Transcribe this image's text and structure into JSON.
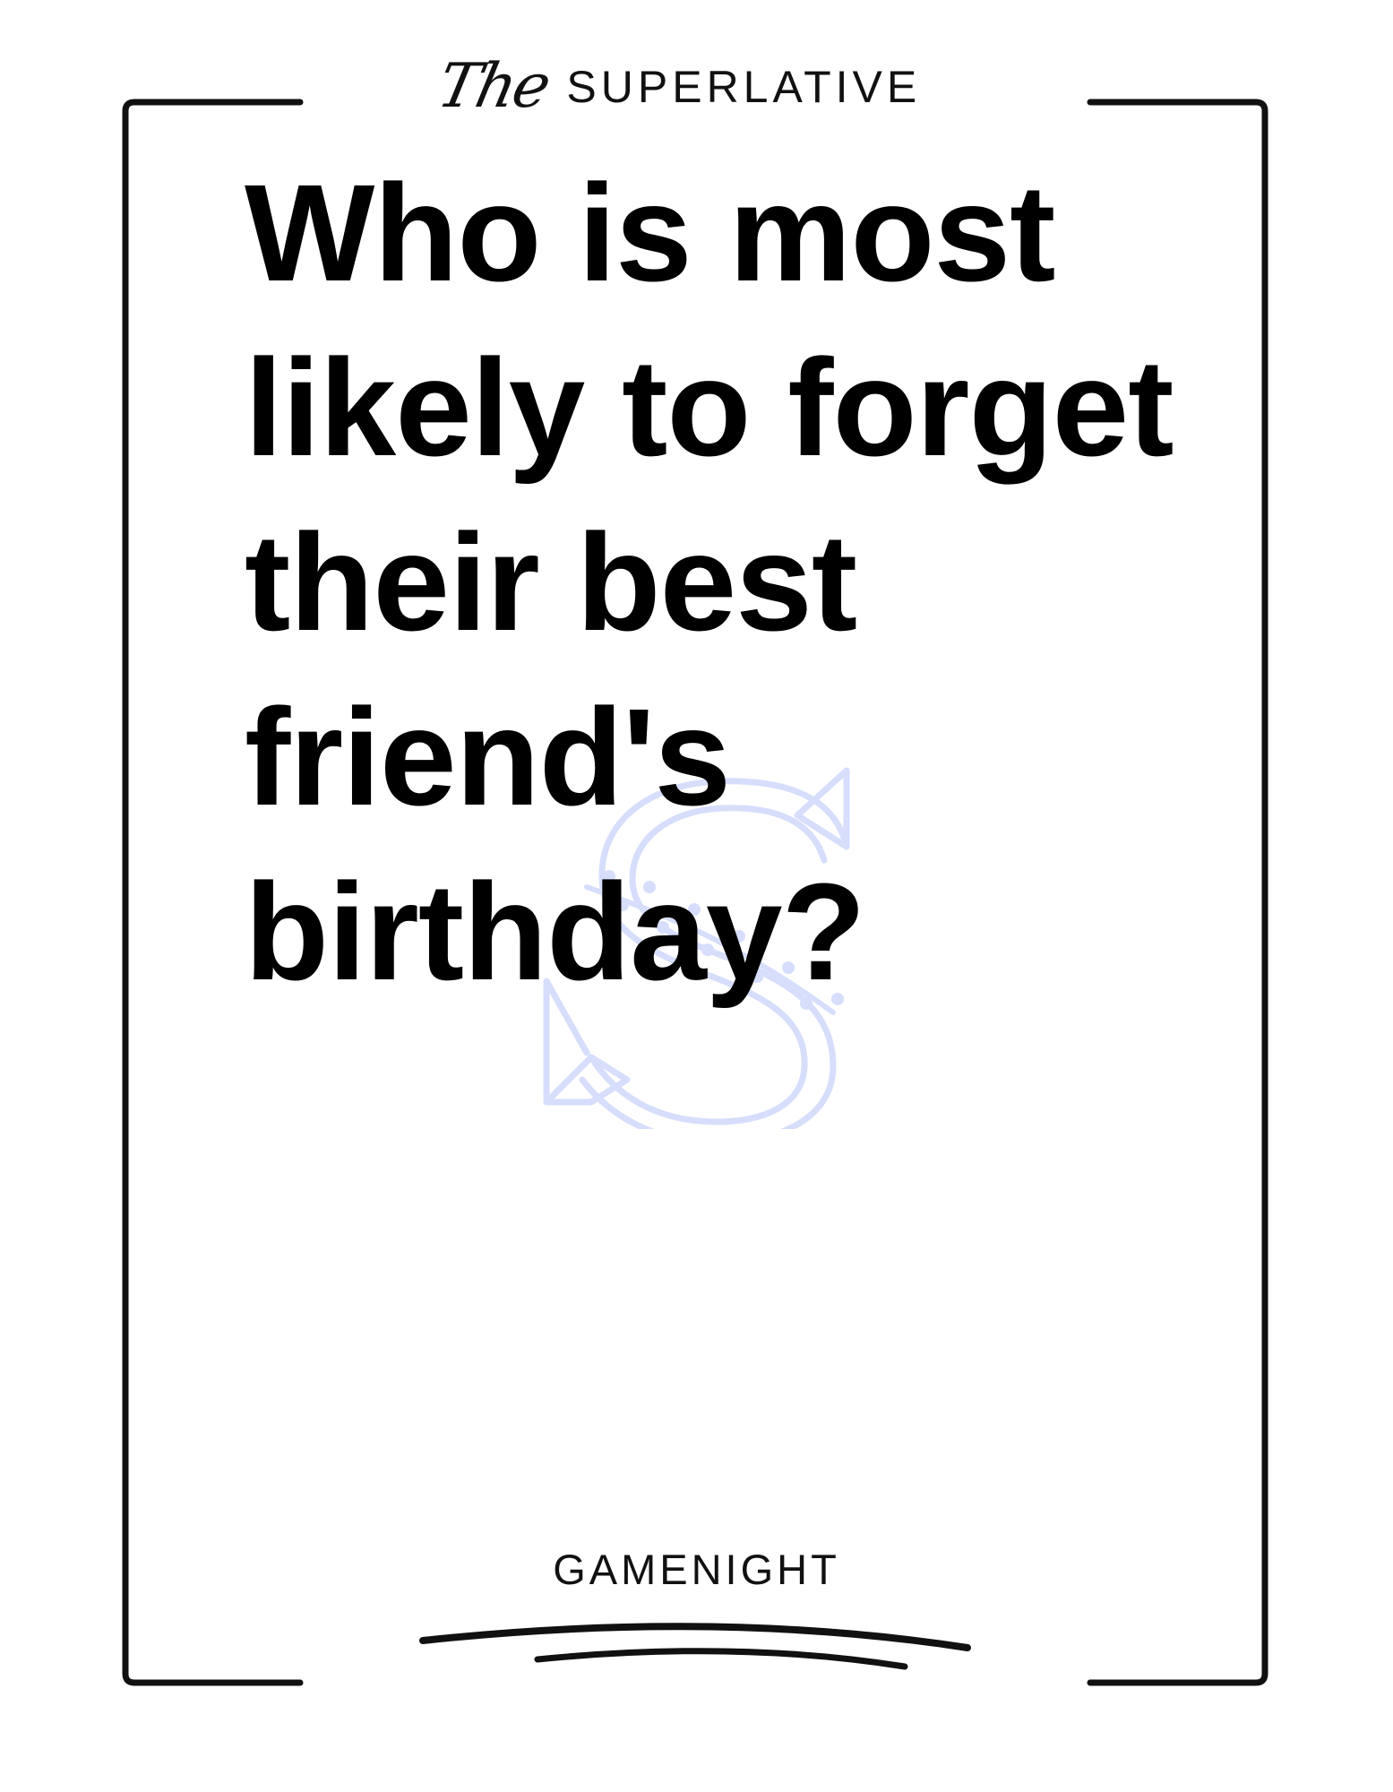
{
  "brand": {
    "script": "The",
    "name": "SUPERLATIVE"
  },
  "card": {
    "question": "Who is most likely to forget their best friend's birthday?"
  },
  "footer": {
    "label": "GAMENIGHT"
  },
  "colors": {
    "ink": "#000000",
    "watermark": "#d6defc",
    "background": "#ffffff"
  }
}
